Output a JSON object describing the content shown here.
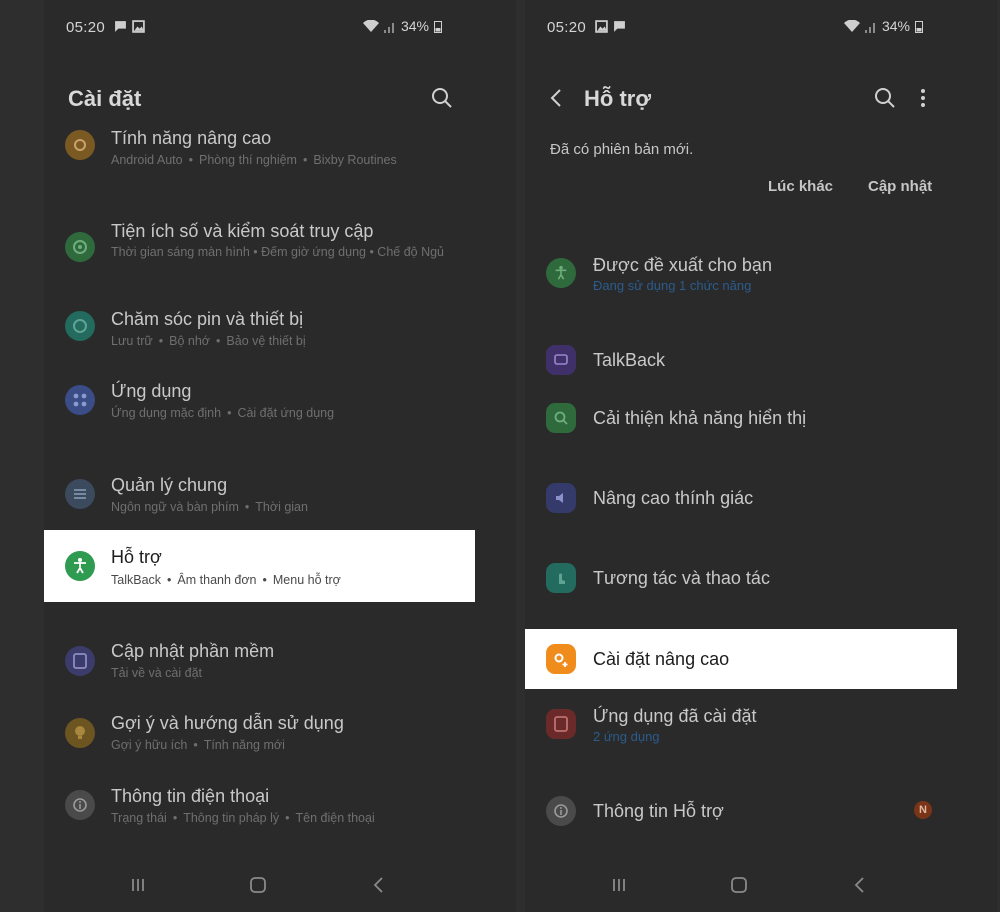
{
  "left": {
    "status": {
      "time": "05:20",
      "battery": "34%"
    },
    "header": {
      "title": "Cài đặt"
    },
    "items": [
      {
        "title": "Tính năng nâng cao",
        "sub": [
          "Android Auto",
          "Phòng thí nghiệm",
          "Bixby Routines"
        ]
      },
      {
        "title": "Tiện ích số và kiểm soát truy cập",
        "sub_text": "Thời gian sáng màn hình  •  Đếm giờ ứng dụng  •  Chế độ Ngủ"
      },
      {
        "title": "Chăm sóc pin và thiết bị",
        "sub": [
          "Lưu trữ",
          "Bộ nhớ",
          "Bảo vệ thiết bị"
        ]
      },
      {
        "title": "Ứng dụng",
        "sub": [
          "Ứng dụng mặc định",
          "Cài đặt ứng dụng"
        ]
      },
      {
        "title": "Quản lý chung",
        "sub": [
          "Ngôn ngữ và bàn phím",
          "Thời gian"
        ]
      },
      {
        "title": "Hỗ trợ",
        "sub": [
          "TalkBack",
          "Âm thanh đơn",
          "Menu hỗ trợ"
        ]
      },
      {
        "title": "Cập nhật phần mềm",
        "sub": [
          "Tải về và cài đặt"
        ]
      },
      {
        "title": "Gợi ý và hướng dẫn sử dụng",
        "sub": [
          "Gợi ý hữu ích",
          "Tính năng mới"
        ]
      },
      {
        "title": "Thông tin điện thoại",
        "sub": [
          "Trạng thái",
          "Thông tin pháp lý",
          "Tên điện thoại"
        ]
      }
    ]
  },
  "right": {
    "status": {
      "time": "05:20",
      "battery": "34%"
    },
    "header": {
      "title": "Hỗ trợ"
    },
    "update": {
      "message": "Đã có phiên bản mới.",
      "later_label": "Lúc khác",
      "update_label": "Cập nhật"
    },
    "items": [
      {
        "title": "Được đề xuất cho bạn",
        "sub": "Đang sử dụng 1 chức năng"
      },
      {
        "title": "TalkBack"
      },
      {
        "title": "Cải thiện khả năng hiển thị"
      },
      {
        "title": "Nâng cao thính giác"
      },
      {
        "title": "Tương tác và thao tác"
      },
      {
        "title": "Cài đặt nâng cao"
      },
      {
        "title": "Ứng dụng đã cài đặt",
        "sub": "2 ứng dụng"
      },
      {
        "title": "Thông tin Hỗ trợ",
        "badge": "N"
      }
    ]
  },
  "colors": {
    "highlight_bg": "#ffffff",
    "accessibility_green": "#2e9b50",
    "advanced_orange": "#f08c1c",
    "badge_red": "#c0471f",
    "dim_bg": "#2a2a2a"
  }
}
